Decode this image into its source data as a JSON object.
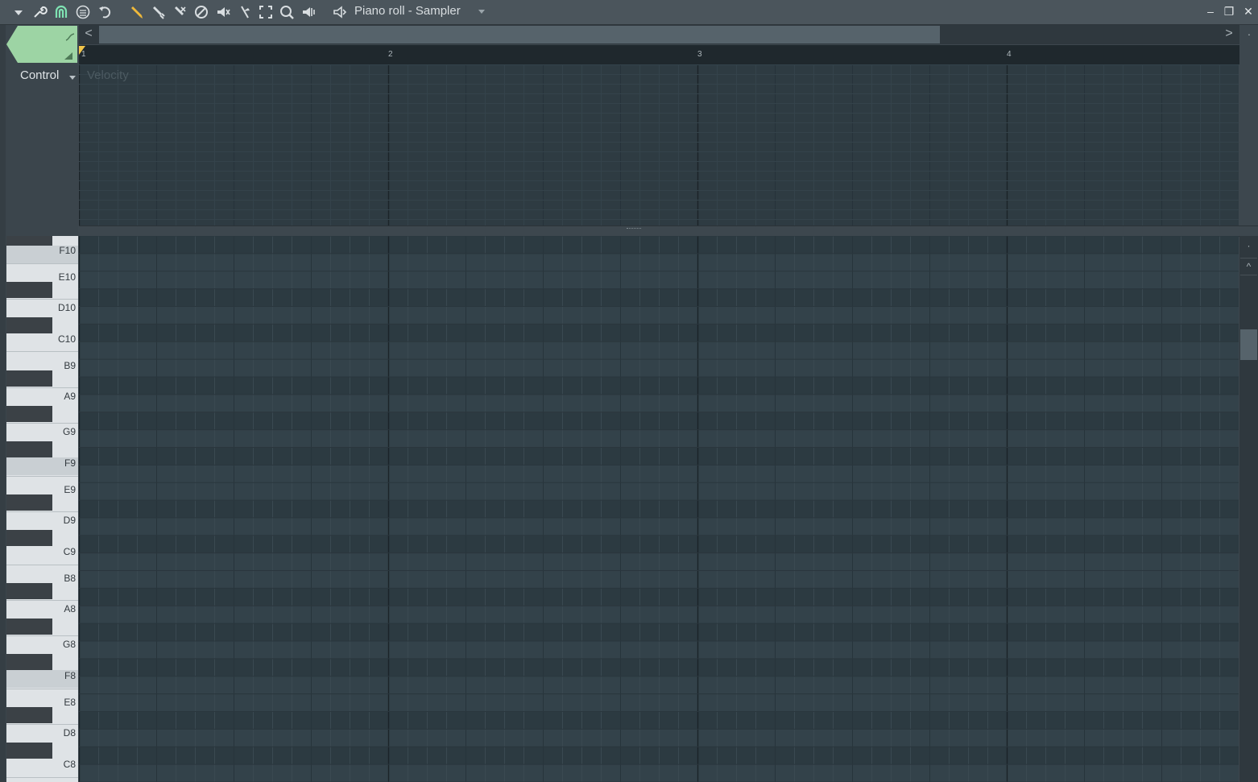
{
  "window": {
    "title": "Piano roll - Sampler",
    "minimize_glyph": "–",
    "restore_glyph": "❐",
    "close_glyph": "✕"
  },
  "toolbar": {
    "icons": [
      "menu-arrow-icon",
      "wrench-icon",
      "magnet-icon",
      "stamp-icon",
      "undo-icon",
      "pencil-icon",
      "paint-brush-icon",
      "erase-icon",
      "mute-icon",
      "slice-icon",
      "select-icon",
      "zoom-icon",
      "playback-icon",
      "speaker-icon"
    ]
  },
  "control": {
    "label": "Control",
    "event_label": "Velocity"
  },
  "timeline": {
    "bars": [
      "1",
      "2",
      "3",
      "4"
    ]
  },
  "scroll": {
    "left_arrow": "<",
    "right_arrow": ">",
    "dot": "·",
    "up_arrow": "^",
    "top_dot": "·"
  },
  "keyboard": {
    "labels": [
      "F10",
      "E10",
      "D10",
      "C10",
      "B9",
      "A9",
      "G9",
      "F9",
      "E9",
      "D9",
      "C9",
      "B8",
      "A8",
      "G8",
      "F8",
      "E8",
      "D8",
      "C8"
    ]
  },
  "colors": {
    "accent_hex_green": "#9dd4a4",
    "playhead_yellow": "#f2c54a",
    "grid_bg": "#33424a",
    "grid_row_dark": "#2c3a41"
  }
}
